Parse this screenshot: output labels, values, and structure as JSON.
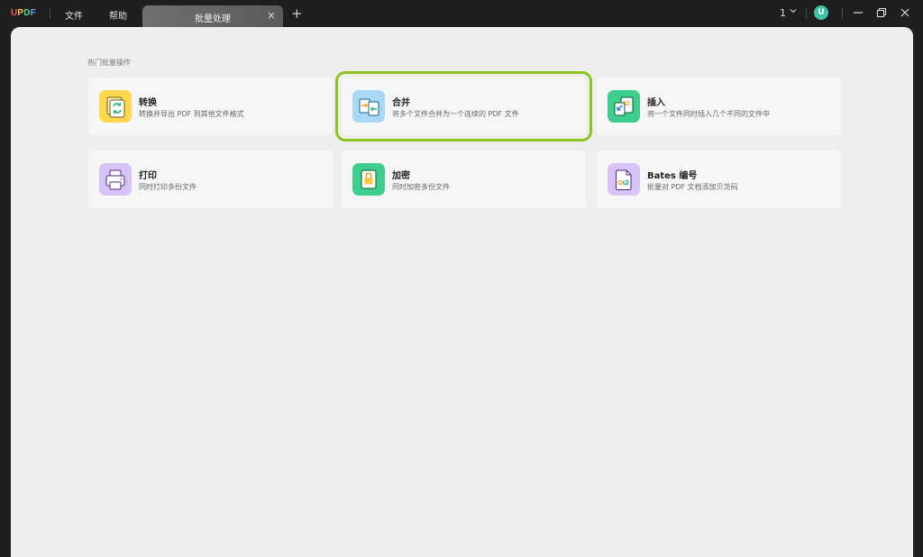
{
  "titlebar": {
    "logo_letters": [
      "U",
      "P",
      "D",
      "F"
    ],
    "menu": {
      "file": "文件",
      "help": "帮助"
    },
    "tab": {
      "label": "批量处理",
      "close": "×"
    },
    "add_tab": "+",
    "page_number": "1",
    "avatar_letter": "U",
    "avatar_color": "#3fc1a8"
  },
  "main": {
    "section_title": "热门批量操作",
    "cards": [
      {
        "title": "转换",
        "description": "转换并导出 PDF 到其他文件格式",
        "icon": "convert-icon",
        "icon_color": "#ffd84d"
      },
      {
        "title": "合并",
        "description": "将多个文件合并为一个连续的 PDF 文件",
        "icon": "merge-icon",
        "icon_color": "#a9d8f5"
      },
      {
        "title": "插入",
        "description": "将一个文件同时插入几个不同的文件中",
        "icon": "insert-icon",
        "icon_color": "#3ecf8e"
      },
      {
        "title": "打印",
        "description": "同时打印多份文件",
        "icon": "print-icon",
        "icon_color": "#d9c2f7"
      },
      {
        "title": "加密",
        "description": "同时加密多份文件",
        "icon": "encrypt-icon",
        "icon_color": "#3ecf8e"
      },
      {
        "title": "Bates 编号",
        "description": "批量对 PDF 文档添加贝茨码",
        "icon": "bates-number-icon",
        "icon_color": "#d9c2f7"
      }
    ],
    "highlight_color": "#8fc31f"
  }
}
